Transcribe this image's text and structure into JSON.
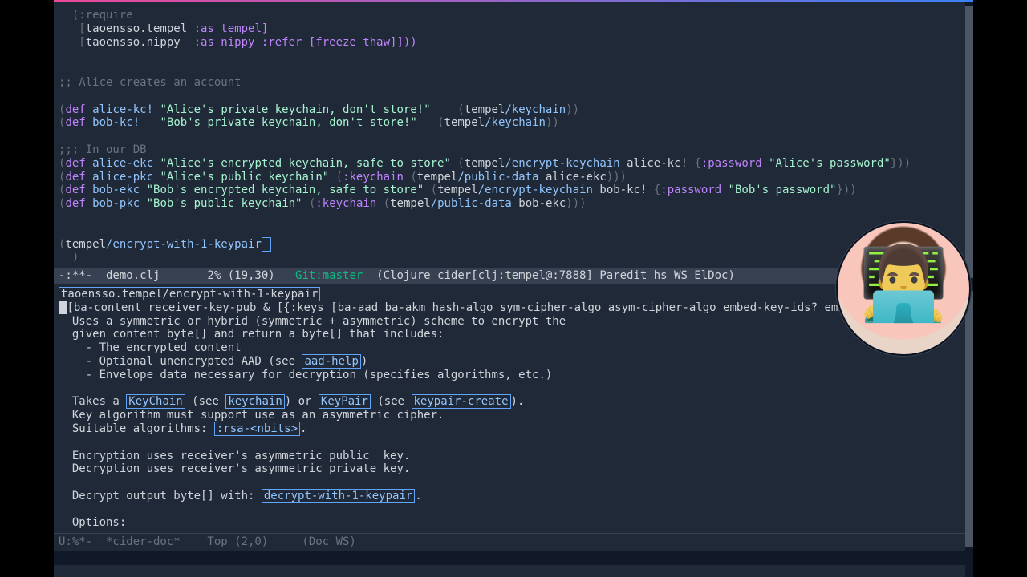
{
  "code": {
    "require_line": "  (:require",
    "req1_open": "   [",
    "req1_ns": "taoensso.tempel",
    "req1_rest": " :as tempel]",
    "req2_open": "   [",
    "req2_ns": "taoensso.nippy",
    "req2_rest": "  :as nippy :refer [freeze thaw]]))",
    "comment1": ";; Alice creates an account",
    "def": "def",
    "alice_kc_sym": "alice-kc!",
    "alice_kc_str": "\"Alice's private keychain, don't store!\"",
    "alice_kc_call_ns": "tempel",
    "alice_kc_call_fn": "/keychain",
    "bob_kc_sym": "bob-kc!",
    "bob_kc_str": "\"Bob's private keychain, don't store!\"",
    "comment2": ";;; In our DB",
    "alice_ekc_sym": "alice-ekc",
    "alice_ekc_str": "\"Alice's encrypted keychain, safe to store\"",
    "alice_ekc_fn": "/encrypt-keychain",
    "alice_ekc_arg": "alice-kc!",
    "alice_ekc_pw_kw": ":password",
    "alice_ekc_pw_str": "\"Alice's password\"",
    "alice_pkc_sym": "alice-pkc",
    "alice_pkc_str": "\"Alice's public keychain\"",
    "alice_pkc_kw": ":keychain",
    "alice_pkc_fn": "/public-data",
    "alice_pkc_arg": "alice-ekc",
    "bob_ekc_sym": "bob-ekc",
    "bob_ekc_str": "\"Bob's encrypted keychain, safe to store\"",
    "bob_ekc_arg": "bob-kc!",
    "bob_ekc_pw_str": "\"Bob's password\"",
    "bob_pkc_sym": "bob-pkc",
    "bob_pkc_str": "\"Bob's public keychain\"",
    "bob_pkc_arg": "bob-ekc",
    "cursor_ns": "tempel",
    "cursor_fn": "/encrypt-with-1-keypair",
    "cursor_close": "  )"
  },
  "modeline": {
    "left": "-:**-  demo.clj       2% (19,30)   ",
    "git": "Git:master",
    "right": "  (Clojure cider[clj:tempel@:7888] Paredit hs WS ElDoc)"
  },
  "doc": {
    "title": "taoensso.tempel/encrypt-with-1-keypair",
    "arglist": "[ba-content receiver-key-pub & [{:keys [ba-aad ba-akm hash-algo sym-cipher-algo asym-cipher-algo embed-key-ids? embed-h",
    "l1": "  Uses a symmetric or hybrid (symmetric + asymmetric) scheme to encrypt the",
    "l2": "  given content byte[] and return a byte[] that includes:",
    "l3": "    - The encrypted content",
    "l4a": "    - Optional unencrypted AAD (see ",
    "aad_help": "aad-help",
    "l4b": ")",
    "l5": "    - Envelope data necessary for decryption (specifies algorithms, etc.)",
    "l6a": "  Takes a ",
    "keychain_cap": "KeyChain",
    "l6b": " (see ",
    "keychain": "keychain",
    "l6c": ") or ",
    "keypair_cap": "KeyPair",
    "l6d": " (see ",
    "keypair_create": "keypair-create",
    "l6e": ").",
    "l7": "  Key algorithm must support use as an asymmetric cipher.",
    "l8a": "  Suitable algorithms: ",
    "rsa": ":rsa-<nbits>",
    "l8b": ".",
    "l9": "  Encryption uses receiver's asymmetric public  key.",
    "l10": "  Decryption uses receiver's asymmetric private key.",
    "l11a": "  Decrypt output byte[] with: ",
    "decrypt_fn": "decrypt-with-1-keypair",
    "l11b": ".",
    "l12": "  Options:"
  },
  "modeline2": {
    "text": "U:%*-  *cider-doc*    Top (2,0)     (Doc WS)"
  }
}
